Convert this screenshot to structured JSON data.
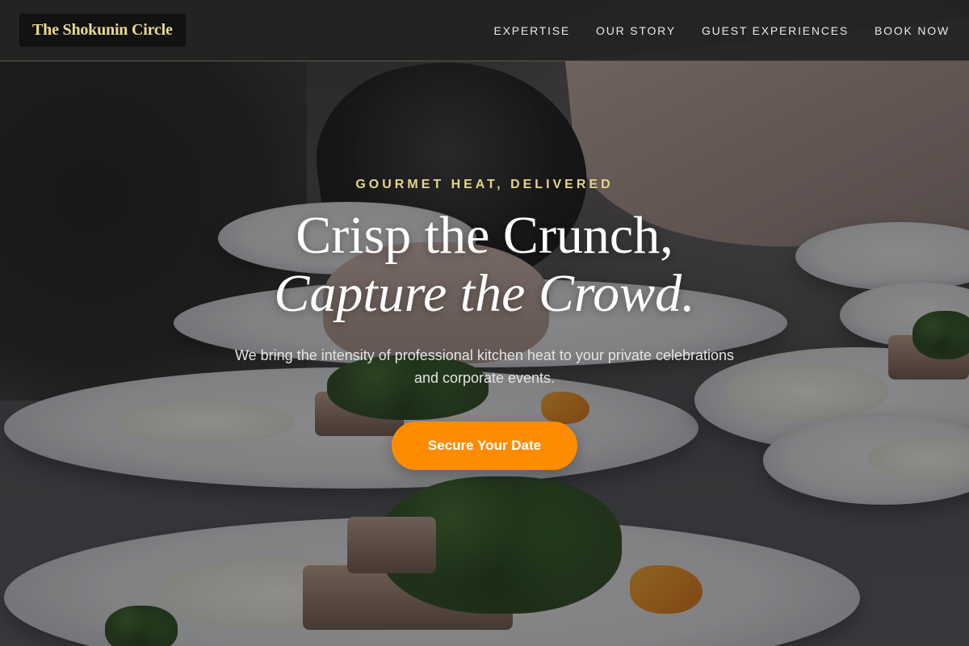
{
  "brand": {
    "name": "The Shokunin Circle",
    "color": "#e8d991"
  },
  "nav": {
    "items": [
      {
        "label": "EXPERTISE"
      },
      {
        "label": "OUR STORY"
      },
      {
        "label": "GUEST EXPERIENCES"
      },
      {
        "label": "BOOK NOW"
      }
    ]
  },
  "hero": {
    "eyebrow": "GOURMET HEAT, DELIVERED",
    "headline_line1": "Crisp the Crunch,",
    "headline_line2": "Capture the Crowd.",
    "subtext": "We bring the intensity of professional kitchen heat to your private celebrations and corporate events.",
    "cta_label": "Secure Your Date",
    "cta_color": "#ff8c00",
    "eyebrow_color": "#e6d48a",
    "background_image": "plated-dishes-kitchen-photo"
  }
}
